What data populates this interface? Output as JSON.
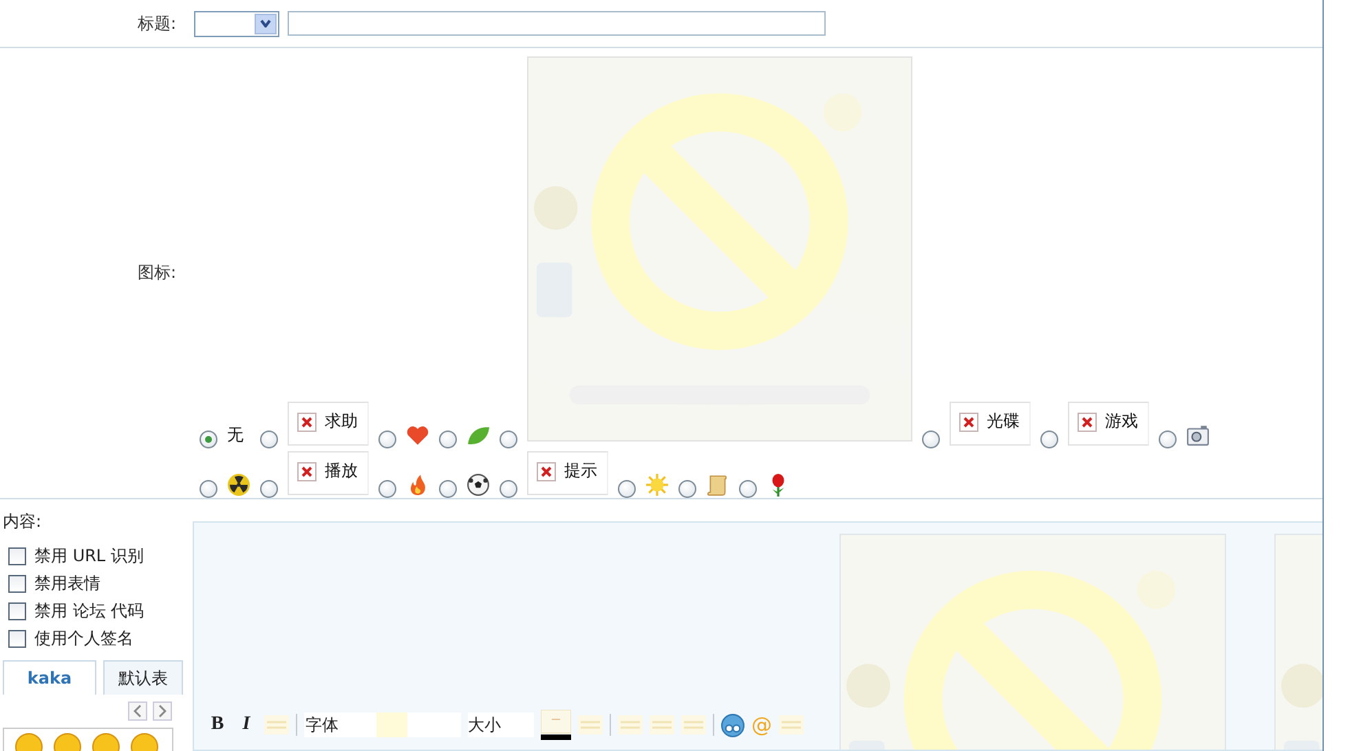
{
  "title_row": {
    "label": "标题:"
  },
  "icon_row": {
    "label": "图标:",
    "rows": [
      {
        "options": [
          {
            "kind": "text",
            "label": "无",
            "selected": true
          },
          {
            "kind": "broken-image",
            "label": "求助",
            "selected": false
          },
          {
            "kind": "heart",
            "selected": false
          },
          {
            "kind": "leaf",
            "selected": false
          },
          {
            "kind": "picture",
            "selected": false
          },
          {
            "kind": "broken-image",
            "label": "光碟",
            "selected": false
          },
          {
            "kind": "broken-image",
            "label": "游戏",
            "selected": false
          },
          {
            "kind": "camera",
            "selected": false
          }
        ]
      },
      {
        "options": [
          {
            "kind": "radiation",
            "selected": false
          },
          {
            "kind": "broken-image",
            "label": "播放",
            "selected": false
          },
          {
            "kind": "fire",
            "selected": false
          },
          {
            "kind": "ball",
            "selected": false
          },
          {
            "kind": "broken-image",
            "label": "提示",
            "selected": false
          },
          {
            "kind": "sun",
            "selected": false
          },
          {
            "kind": "scroll",
            "selected": false
          },
          {
            "kind": "rose",
            "selected": false
          }
        ]
      }
    ]
  },
  "content": {
    "label": "内容:",
    "options": [
      {
        "label": "禁用 URL 识别",
        "checked": false
      },
      {
        "label": "禁用表情",
        "checked": false
      },
      {
        "label": "禁用 论坛 代码",
        "checked": false
      },
      {
        "label": "使用个人签名",
        "checked": false
      }
    ],
    "emoticon_tabs": [
      {
        "label": "kaka",
        "selected": true
      },
      {
        "label": "默认表",
        "selected": false
      }
    ]
  },
  "editor": {
    "toolbar": [
      {
        "kind": "bold",
        "text": "B"
      },
      {
        "kind": "italic",
        "text": "I"
      },
      {
        "kind": "faded"
      },
      {
        "kind": "divider"
      },
      {
        "kind": "font-select",
        "label": "字体"
      },
      {
        "kind": "size-select",
        "label": "大小"
      },
      {
        "kind": "color"
      },
      {
        "kind": "faded"
      },
      {
        "kind": "divider"
      },
      {
        "kind": "faded"
      },
      {
        "kind": "faded"
      },
      {
        "kind": "faded"
      },
      {
        "kind": "divider"
      },
      {
        "kind": "emoticon"
      },
      {
        "kind": "at",
        "text": "@"
      },
      {
        "kind": "faded"
      }
    ],
    "pictures": [
      {
        "kind": "picture"
      },
      {
        "kind": "picture"
      }
    ]
  }
}
